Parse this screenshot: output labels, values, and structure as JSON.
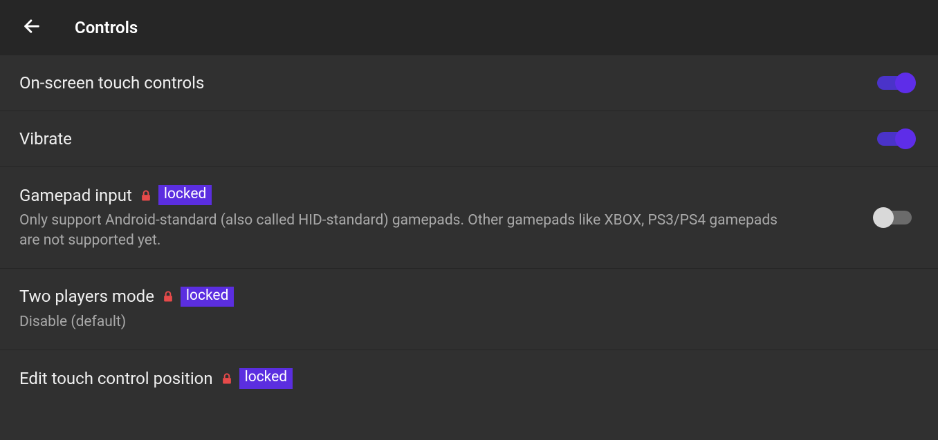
{
  "header": {
    "title": "Controls"
  },
  "settings": {
    "touch": {
      "title": "On-screen touch controls"
    },
    "vibrate": {
      "title": "Vibrate"
    },
    "gamepad": {
      "title": "Gamepad input",
      "locked_label": "locked",
      "subtitle": "Only support Android-standard (also called HID-standard) gamepads. Other gamepads like XBOX, PS3/PS4 gamepads are not supported yet."
    },
    "twoPlayers": {
      "title": "Two players mode",
      "locked_label": "locked",
      "subtitle": "Disable (default)"
    },
    "editTouch": {
      "title": "Edit touch control position",
      "locked_label": "locked"
    }
  },
  "colors": {
    "accent": "#5e2de8",
    "lock": "#e74a4a"
  }
}
